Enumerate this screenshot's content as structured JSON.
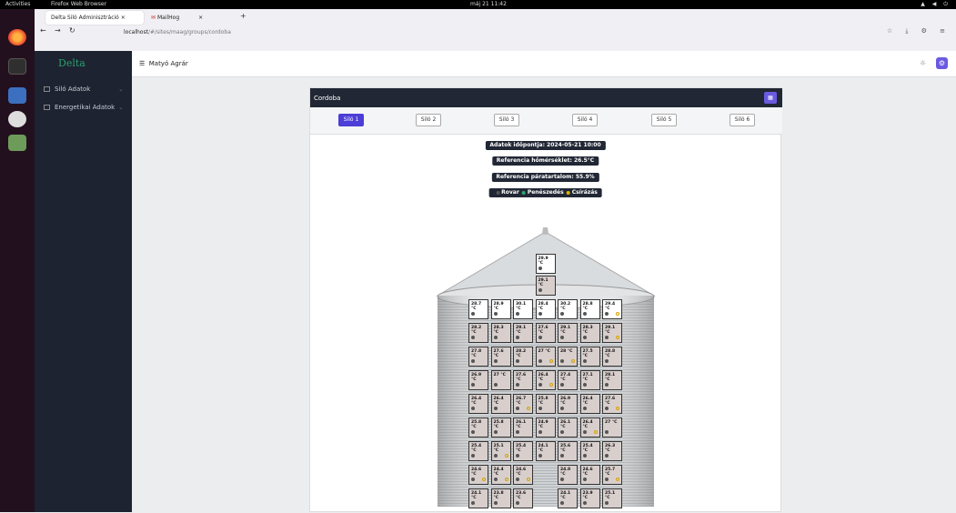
{
  "os": {
    "activities": "Activities",
    "app_name": "Firefox Web Browser",
    "clock": "máj 21  11:42"
  },
  "browser": {
    "tabs": [
      {
        "label": "Delta Siló Adminisztráció"
      },
      {
        "label": "MailHog"
      }
    ],
    "url_host": "localhost",
    "url_path": "/#/sites/maag/groups/cordoba"
  },
  "sidebar": {
    "logo": "Delta",
    "items": [
      {
        "label": "Siló Adatok"
      },
      {
        "label": "Energetikai Adatok"
      }
    ]
  },
  "header": {
    "company": "Matyó Agrár"
  },
  "card": {
    "title": "Cordoba",
    "silo_tabs": [
      "Siló 1",
      "Siló 2",
      "Siló 3",
      "Siló 4",
      "Siló 5",
      "Siló 6"
    ],
    "active_tab": 0,
    "info": {
      "timestamp": "Adatok időpontja: 2024-05-21 10:00",
      "ref_temp": "Referencia hőmérséklet: 26.5°C",
      "ref_humidity": "Referencia páratartalom: 55.9%"
    },
    "legend": [
      {
        "label": "Rovar",
        "color": "#555555"
      },
      {
        "label": "Penészedés",
        "color": "#2aa76a"
      },
      {
        "label": "Csírázás",
        "color": "#e0b400"
      }
    ]
  },
  "silo": {
    "roof_sensors": [
      "29.9 °C",
      "29.1 °C"
    ],
    "rows": [
      [
        "28.7 °C",
        "28.9 °C",
        "30.1 °C",
        "28.4 °C",
        "30.2 °C",
        "28.8 °C",
        "29.4 °C"
      ],
      [
        "28.2 °C",
        "28.3 °C",
        "29.1 °C",
        "27.6 °C",
        "29.1 °C",
        "28.3 °C",
        "29.1 °C"
      ],
      [
        "27.8 °C",
        "27.6 °C",
        "28.2 °C",
        "27 °C",
        "28 °C",
        "27.5 °C",
        "28.8 °C"
      ],
      [
        "26.9 °C",
        "27 °C",
        "27.6 °C",
        "26.4 °C",
        "27.4 °C",
        "27.1 °C",
        "28.1 °C"
      ],
      [
        "26.4 °C",
        "26.4 °C",
        "26.7 °C",
        "25.8 °C",
        "26.9 °C",
        "26.4 °C",
        "27.6 °C"
      ],
      [
        "25.8 °C",
        "25.8 °C",
        "26.1 °C",
        "24.9 °C",
        "26.1 °C",
        "26.4 °C",
        "27 °C"
      ],
      [
        "25.4 °C",
        "25.1 °C",
        "25.4 °C",
        "24.1 °C",
        "25.6 °C",
        "25.4 °C",
        "26.3 °C"
      ],
      [
        "24.6 °C",
        "24.4 °C",
        "24.6 °C",
        "",
        "24.8 °C",
        "24.6 °C",
        "25.7 °C"
      ],
      [
        "24.1 °C",
        "23.8 °C",
        "23.6 °C",
        "",
        "24.1 °C",
        "23.9 °C",
        "25.1 °C"
      ]
    ],
    "yellow": [
      [
        0,
        0,
        0,
        0,
        0,
        0,
        1
      ],
      [
        0,
        0,
        0,
        0,
        0,
        0,
        1
      ],
      [
        0,
        0,
        0,
        1,
        1,
        0,
        0
      ],
      [
        0,
        0,
        0,
        1,
        0,
        0,
        0
      ],
      [
        0,
        0,
        1,
        0,
        0,
        0,
        1
      ],
      [
        0,
        0,
        0,
        0,
        0,
        1,
        0
      ],
      [
        0,
        1,
        0,
        0,
        0,
        0,
        0
      ],
      [
        1,
        1,
        1,
        0,
        0,
        0,
        1
      ],
      [
        0,
        0,
        0,
        0,
        0,
        0,
        0
      ]
    ]
  }
}
